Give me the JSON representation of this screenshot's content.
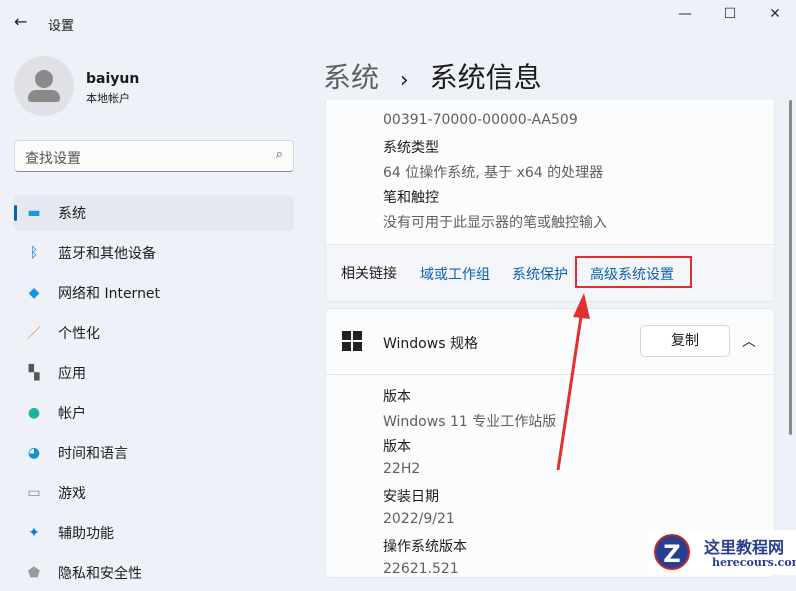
{
  "title": "设置",
  "window": {
    "minimize": "—",
    "maximize": "☐",
    "close": "✕"
  },
  "user": {
    "name": "baiyun",
    "account": "本地帐户"
  },
  "search": {
    "placeholder": "查找设置"
  },
  "nav": [
    {
      "label": "系统",
      "icon": "monitor-icon",
      "glyph": "▬",
      "color": "#1a9bd7"
    },
    {
      "label": "蓝牙和其他设备",
      "icon": "bluetooth-icon",
      "glyph": "ᛒ",
      "color": "#0a78d7"
    },
    {
      "label": "网络和 Internet",
      "icon": "wifi-icon",
      "glyph": "◆",
      "color": "#1a8fe0"
    },
    {
      "label": "个性化",
      "icon": "brush-icon",
      "glyph": "／",
      "color": "#e07b39"
    },
    {
      "label": "应用",
      "icon": "apps-icon",
      "glyph": "▚",
      "color": "#555"
    },
    {
      "label": "帐户",
      "icon": "person-icon",
      "glyph": "●",
      "color": "#1fb39a"
    },
    {
      "label": "时间和语言",
      "icon": "globe-clock-icon",
      "glyph": "◕",
      "color": "#1a8fd0"
    },
    {
      "label": "游戏",
      "icon": "gamepad-icon",
      "glyph": "▭",
      "color": "#888"
    },
    {
      "label": "辅助功能",
      "icon": "accessibility-icon",
      "glyph": "✦",
      "color": "#0a78d7"
    },
    {
      "label": "隐私和安全性",
      "icon": "shield-icon",
      "glyph": "⬟",
      "color": "#999"
    }
  ],
  "breadcrumb": {
    "parent": "系统",
    "sep": "›",
    "current": "系统信息"
  },
  "device": {
    "product_id": "00391-70000-00000-AA509",
    "type_label": "系统类型",
    "type_value": "64 位操作系统, 基于 x64 的处理器",
    "pen_label": "笔和触控",
    "pen_value": "没有可用于此显示器的笔或触控输入"
  },
  "related": {
    "label": "相关链接",
    "links": [
      "域或工作组",
      "系统保护",
      "高级系统设置"
    ]
  },
  "windows": {
    "title": "Windows 规格",
    "copy": "复制",
    "rows": [
      {
        "label": "版本",
        "value": "Windows 11 专业工作站版"
      },
      {
        "label": "版本",
        "value": "22H2"
      },
      {
        "label": "安装日期",
        "value": "2022/9/21"
      },
      {
        "label": "操作系统版本",
        "value": "22621.521"
      }
    ]
  },
  "watermark": {
    "name": "这里教程网",
    "url": "herecours.com"
  },
  "colors": {
    "accent": "#0067c0",
    "highlight": "#e03030"
  }
}
